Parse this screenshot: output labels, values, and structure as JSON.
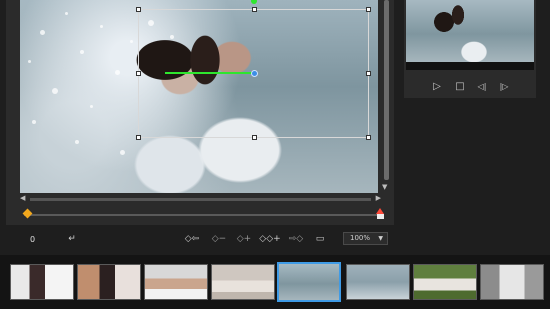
{
  "playback": {
    "time": "0",
    "zoom": "100%",
    "zoom_caret": "▼"
  },
  "icons": {
    "play": "▷",
    "stop": "□",
    "prev_frame": "◁|",
    "next_frame": "|▷",
    "return": "↵",
    "kf_prev": "◇⇦",
    "kf_remove": "◇−",
    "kf_add": "◇+",
    "kf_add_active": "◇◇+",
    "kf_next": "⇨◇",
    "fit": "▭",
    "scroll_up": "▲",
    "scroll_down": "▼",
    "scroll_left": "◀",
    "scroll_right": "▶"
  },
  "filmstrip": {
    "selected_index": 4,
    "count": 8
  },
  "colors": {
    "accent": "#3f9be6",
    "motion_path": "#2ee62e",
    "keyframe_start": "#f2a81d",
    "keyframe_end": "#ff4a3a"
  }
}
